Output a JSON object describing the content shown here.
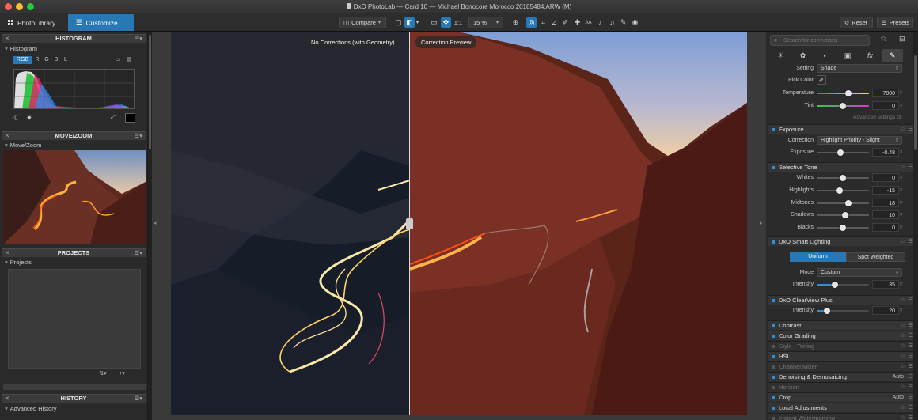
{
  "window": {
    "title": "DxO PhotoLab — Card 10 — Michael Bonocore Morocco 20185484.ARW (M)",
    "traffic_colors": [
      "#fe5f57",
      "#febc2e",
      "#28c840"
    ]
  },
  "toolbar": {
    "photolibrary_label": "PhotoLibrary",
    "customize_label": "Customize",
    "compare_label": "Compare",
    "zoom_1to1": "1:1",
    "zoom_percent": "15 %",
    "reset_label": "Reset",
    "presets_label": "Presets"
  },
  "left": {
    "histogram_title": "HISTOGRAM",
    "histogram_label": "Histogram",
    "channels": [
      "RGB",
      "R",
      "G",
      "B",
      "L"
    ],
    "movezoom_title": "MOVE/ZOOM",
    "movezoom_label": "Move/Zoom",
    "projects_title": "PROJECTS",
    "projects_label": "Projects",
    "history_title": "HISTORY",
    "history_label": "Advanced History"
  },
  "viewer": {
    "left_label": "No Corrections (with Geometry)",
    "right_label": "Correction Preview"
  },
  "right": {
    "search_placeholder": "Search for corrections",
    "wb": {
      "setting_label": "Setting",
      "setting_value": "Shade",
      "pick_color_label": "Pick Color",
      "temperature_label": "Temperature",
      "temperature_value": "7000",
      "tint_label": "Tint",
      "tint_value": "0",
      "advanced_label": "Advanced settings"
    },
    "exposure": {
      "title": "Exposure",
      "correction_label": "Correction",
      "correction_value": "Highlight Priority - Slight",
      "exposure_label": "Exposure",
      "exposure_value": "-0.48"
    },
    "selective_tone": {
      "title": "Selective Tone",
      "whites_label": "Whites",
      "whites_value": "0",
      "highlights_label": "Highlights",
      "highlights_value": "-15",
      "midtones_label": "Midtones",
      "midtones_value": "18",
      "shadows_label": "Shadows",
      "shadows_value": "10",
      "blacks_label": "Blacks",
      "blacks_value": "0"
    },
    "smart_lighting": {
      "title": "DxO Smart Lighting",
      "uniform_label": "Uniform",
      "spot_label": "Spot Weighted",
      "mode_label": "Mode",
      "mode_value": "Custom",
      "intensity_label": "Intensity",
      "intensity_value": "35"
    },
    "clearview": {
      "title": "DxO ClearView Plus",
      "intensity_label": "Intensity",
      "intensity_value": "20"
    },
    "contrast_title": "Contrast",
    "color_grading_title": "Color Grading",
    "style_toning_title": "Style - Toning",
    "hsl_title": "HSL",
    "channel_mixer_title": "Channel Mixer",
    "denoising_title": "Denoising & Demosaicing",
    "denoising_value": "Auto",
    "horizon_title": "Horizon",
    "crop_title": "Crop",
    "crop_value": "Auto",
    "local_adjustments_title": "Local Adjustments",
    "instant_watermarking_title": "Instant Watermarking"
  },
  "sliders": {
    "temperature": 0.6,
    "tint": 0.5,
    "exposure": 0.45,
    "whites": 0.5,
    "highlights": 0.44,
    "midtones": 0.6,
    "shadows": 0.55,
    "blacks": 0.5,
    "smart_intensity": 0.35,
    "clearview_intensity": 0.2
  }
}
